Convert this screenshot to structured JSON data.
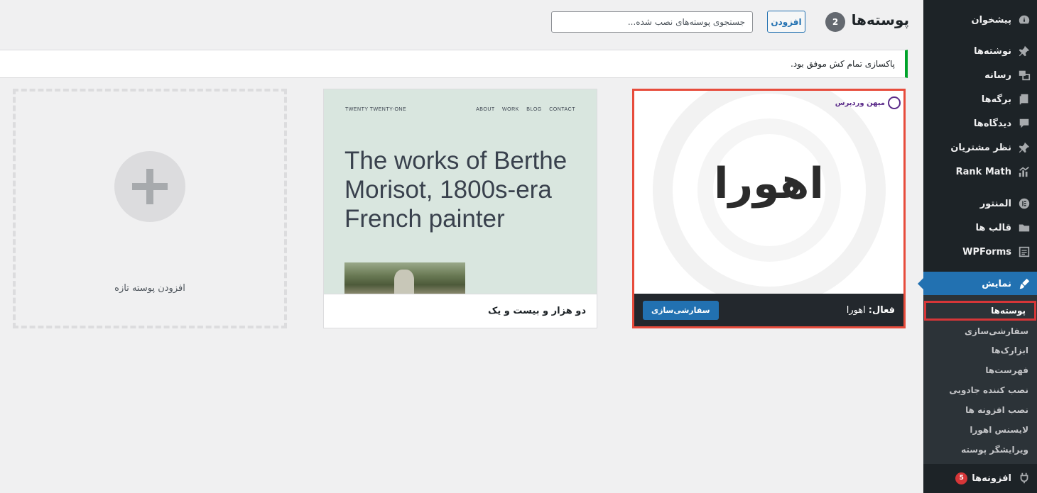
{
  "header": {
    "title": "پوسته‌ها",
    "count": "2",
    "add_label": "افزودن",
    "search_placeholder": "جستجوی پوسته‌های نصب شده..."
  },
  "notice": {
    "text": "پاکسازی تمام کش موفق بود."
  },
  "sidebar": {
    "items": [
      {
        "label": "پیشخوان",
        "icon": "dashboard-icon"
      },
      {
        "label": "نوشته‌ها",
        "icon": "pin-icon"
      },
      {
        "label": "رسانه",
        "icon": "media-icon"
      },
      {
        "label": "برگه‌ها",
        "icon": "pages-icon"
      },
      {
        "label": "دیدگاه‌ها",
        "icon": "comments-icon"
      },
      {
        "label": "نظر مشتریان",
        "icon": "pin-icon"
      },
      {
        "label": "Rank Math",
        "icon": "rank-math-icon"
      },
      {
        "label": "المنتور",
        "icon": "elementor-icon"
      },
      {
        "label": "قالب ها",
        "icon": "folder-icon"
      },
      {
        "label": "WPForms",
        "icon": "wpforms-icon"
      },
      {
        "label": "نمایش",
        "icon": "brush-icon"
      }
    ],
    "submenu": [
      {
        "label": "پوسته‌ها"
      },
      {
        "label": "سفارشی‌سازی"
      },
      {
        "label": "ابزارک‌ها"
      },
      {
        "label": "فهرست‌ها"
      },
      {
        "label": "نصب کننده جادویی"
      },
      {
        "label": "نصب افزونه ها"
      },
      {
        "label": "لایسنس اهورا"
      },
      {
        "label": "ویرایشگر پوسته"
      }
    ],
    "plugins": {
      "label": "افزونه‌ها",
      "badge": "5"
    }
  },
  "themes": {
    "active": {
      "preview_text": "اهورا",
      "brand": "میهن وردپرس",
      "active_prefix": "فعال:",
      "name": "اهورا",
      "customize_label": "سفارشی‌سازی"
    },
    "twenty_twenty_one": {
      "site_title": "TWENTY TWENTY-ONE",
      "nav": [
        "ABOUT",
        "WORK",
        "BLOG",
        "CONTACT"
      ],
      "headline": "The works of Berthe Morisot, 1800s-era French painter",
      "name": "دو هزار و بیست و یک"
    },
    "add_new": {
      "label": "افزودن پوسته تازه"
    }
  },
  "colors": {
    "sidebar_bg": "#1d2327",
    "accent_blue": "#2271b1",
    "highlight_red": "#e74c3c",
    "notice_green": "#00a32a"
  }
}
